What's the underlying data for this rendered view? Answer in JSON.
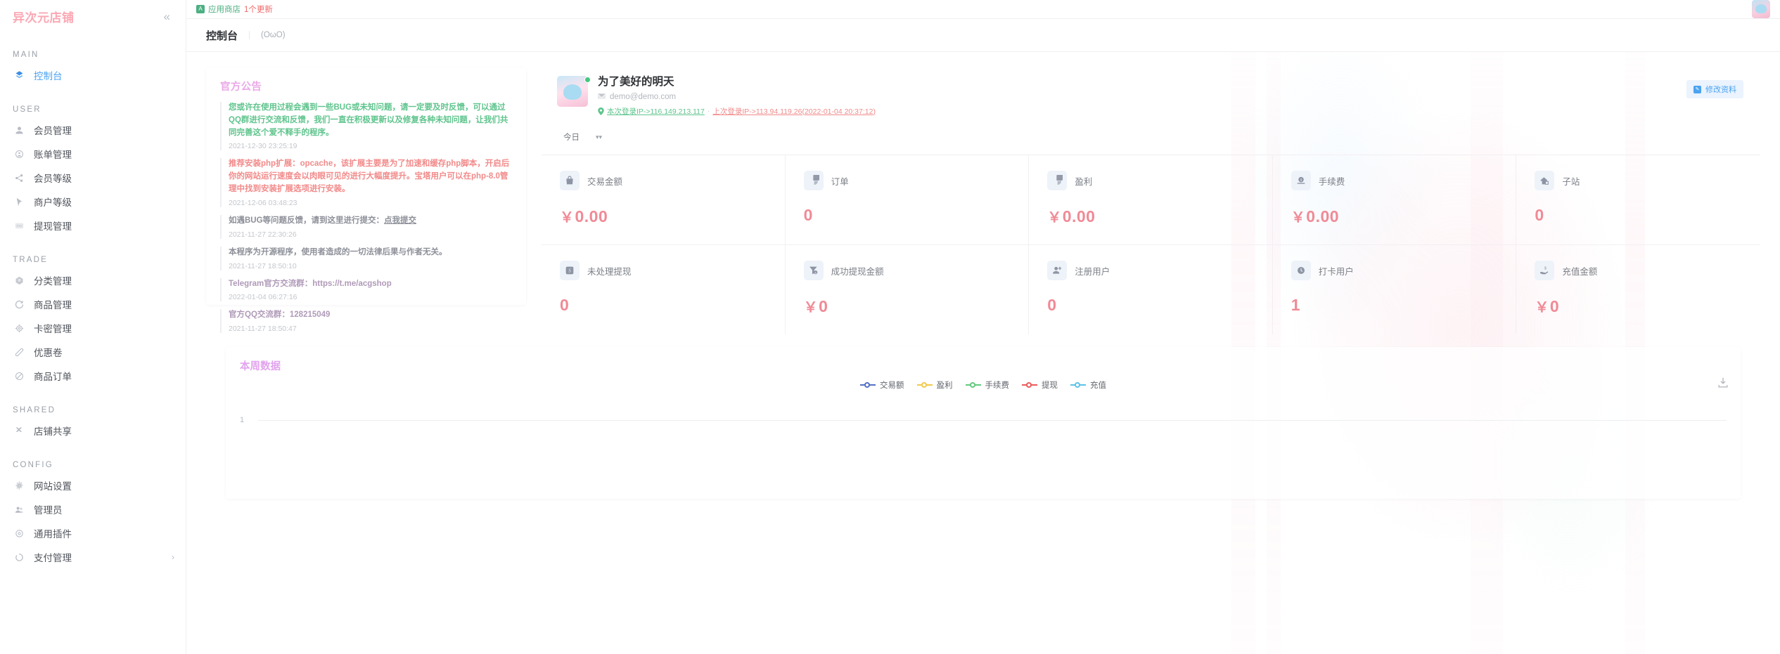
{
  "sidebar": {
    "brand": "异次元店铺",
    "collapse_icon": "chevron-double-left",
    "groups": [
      {
        "label": "MAIN",
        "items": [
          {
            "label": "控制台",
            "icon": "dashboard-icon",
            "active": true
          }
        ]
      },
      {
        "label": "USER",
        "items": [
          {
            "label": "会员管理",
            "icon": "user-icon",
            "active": false
          },
          {
            "label": "账单管理",
            "icon": "bill-icon",
            "active": false
          },
          {
            "label": "会员等级",
            "icon": "share-nodes-icon",
            "active": false
          },
          {
            "label": "商户等级",
            "icon": "cursor-icon",
            "active": false
          },
          {
            "label": "提现管理",
            "icon": "withdraw-icon",
            "active": false
          }
        ]
      },
      {
        "label": "TRADE",
        "items": [
          {
            "label": "分类管理",
            "icon": "category-icon",
            "active": false
          },
          {
            "label": "商品管理",
            "icon": "refresh-icon",
            "active": false
          },
          {
            "label": "卡密管理",
            "icon": "gear-ring-icon",
            "active": false
          },
          {
            "label": "优惠卷",
            "icon": "ticket-icon",
            "active": false
          },
          {
            "label": "商品订单",
            "icon": "ban-circle-icon",
            "active": false
          }
        ]
      },
      {
        "label": "SHARED",
        "items": [
          {
            "label": "店铺共享",
            "icon": "drone-icon",
            "active": false
          }
        ]
      },
      {
        "label": "CONFIG",
        "items": [
          {
            "label": "网站设置",
            "icon": "gear-icon",
            "active": false
          },
          {
            "label": "管理员",
            "icon": "admin-users-icon",
            "active": false
          },
          {
            "label": "通用插件",
            "icon": "plugin-circle-icon",
            "active": false
          },
          {
            "label": "支付管理",
            "icon": "payment-loading-icon",
            "active": false,
            "arrow": "›"
          }
        ]
      }
    ]
  },
  "topbar": {
    "appstore_label": "应用商店",
    "appstore_badge_glyph": "A",
    "appstore_update": "1个更新",
    "avatar_name": "user-avatar"
  },
  "page": {
    "title": "控制台",
    "subtitle": "(OωO)"
  },
  "notice": {
    "heading": "官方公告",
    "items": [
      {
        "text": "您或许在使用过程会遇到一些BUG或未知问题，请一定要及时反馈，可以通过QQ群进行交流和反馈，我们一直在积极更新以及修复各种未知问题，让我们共同完善这个爱不释手的程序。",
        "time": "2021-12-30 23:25:19",
        "color": "green"
      },
      {
        "text": "推荐安装php扩展：opcache，该扩展主要是为了加速和缓存php脚本，开启后你的网站运行速度会以肉眼可见的进行大幅度提升。宝塔用户可以在php-8.0管理中找到安装扩展选项进行安装。",
        "time": "2021-12-06 03:48:23",
        "color": "red"
      },
      {
        "text": "如遇BUG等问题反馈，请到这里进行提交：",
        "link": "点我提交",
        "time": "2021-11-27 22:30:26",
        "color": "grey"
      },
      {
        "text": "本程序为开源程序，使用者造成的一切法律后果与作者无关。",
        "time": "2021-11-27 18:50:10",
        "color": "grey"
      },
      {
        "text": "Telegram官方交流群：https://t.me/acgshop",
        "time": "2022-01-04 06:27:16",
        "color": "purple"
      },
      {
        "text": "官方QQ交流群：128215049",
        "time": "2021-11-27 18:50:47",
        "color": "purple"
      }
    ]
  },
  "profile": {
    "name": "为了美好的明天",
    "email": "demo@demo.com",
    "current_ip": "本次登录IP->116.149.213.117",
    "ip_separator": "·",
    "previous_ip": "上次登录IP->113.94.119.26(2022-01-04 20:37:12)",
    "edit_button": "修改资料",
    "status": "online"
  },
  "range": {
    "selected": "今日"
  },
  "stats": [
    {
      "label": "交易金额",
      "value": "0.00",
      "currency": "￥",
      "icon": "bag-icon"
    },
    {
      "label": "订单",
      "value": "0",
      "currency": "",
      "icon": "pie-chart-icon"
    },
    {
      "label": "盈利",
      "value": "0.00",
      "currency": "￥",
      "icon": "pie-chart-icon"
    },
    {
      "label": "手续费",
      "value": "0.00",
      "currency": "￥",
      "icon": "coin-icon"
    },
    {
      "label": "子站",
      "value": "0",
      "currency": "",
      "icon": "house-icon"
    },
    {
      "label": "未处理提现",
      "value": "0",
      "currency": "",
      "icon": "s-badge-icon"
    },
    {
      "label": "成功提现金额",
      "value": "0",
      "currency": "￥",
      "icon": "funnel-coin-icon"
    },
    {
      "label": "注册用户",
      "value": "0",
      "currency": "",
      "icon": "user-plus-icon"
    },
    {
      "label": "打卡用户",
      "value": "1",
      "currency": "",
      "icon": "clock-icon"
    },
    {
      "label": "充值金额",
      "value": "0",
      "currency": "￥",
      "icon": "hand-coin-icon"
    }
  ],
  "chart_data": {
    "type": "line",
    "title": "本周数据",
    "download_icon": "download-icon",
    "legend_position": "top-center",
    "grid": true,
    "xlabel": "",
    "ylabel": "",
    "ylim": [
      0,
      1
    ],
    "yticks": [
      "1"
    ],
    "x": [],
    "series": [
      {
        "name": "交易额",
        "color": "#5470c6",
        "values": []
      },
      {
        "name": "盈利",
        "color": "#f2c94c",
        "values": []
      },
      {
        "name": "手续费",
        "color": "#63c97f",
        "values": []
      },
      {
        "name": "提现",
        "color": "#ee5a5a",
        "values": []
      },
      {
        "name": "充值",
        "color": "#5bc3e8",
        "values": []
      }
    ]
  },
  "colors": {
    "brand_pink": "#fba8b4",
    "accent_blue": "#4aa3f0",
    "stat_value": "#f08a96",
    "heading_purple": "#eaa8e8",
    "notice_green": "#5fc48d",
    "notice_red": "#f28a8a"
  }
}
